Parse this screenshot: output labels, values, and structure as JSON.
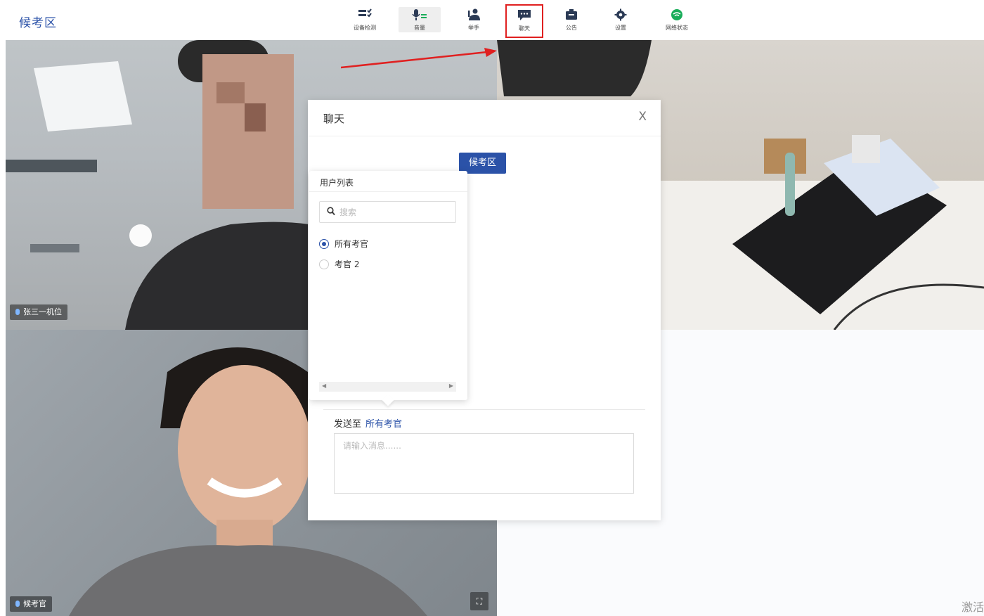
{
  "app": {
    "title": "候考区"
  },
  "toolbar": {
    "items": [
      {
        "label": "设备检测",
        "icon": "device-check-icon"
      },
      {
        "label": "音量",
        "icon": "microphone-volume-icon"
      },
      {
        "label": "举手",
        "icon": "raise-hand-icon"
      },
      {
        "label": "聊天",
        "icon": "chat-icon"
      },
      {
        "label": "公告",
        "icon": "announcement-icon"
      },
      {
        "label": "设置",
        "icon": "gear-icon"
      },
      {
        "label": "网络状态",
        "icon": "network-status-icon"
      }
    ]
  },
  "videos": {
    "tile1_name": "张三一机位",
    "tile3_name": "候考官"
  },
  "chat": {
    "title": "聊天",
    "close": "X",
    "room_tag": "候考区",
    "send_to_label": "发送至",
    "send_to_target": "所有考官",
    "message_placeholder": "请输入消息......"
  },
  "user_list": {
    "title": "用户列表",
    "search_placeholder": "搜索",
    "users": [
      {
        "label": "所有考官",
        "selected": true
      },
      {
        "label": "考官 2",
        "selected": false
      }
    ]
  },
  "watermark": "激活",
  "colors": {
    "accent": "#2b52a8",
    "highlight": "#e02020",
    "network_ok": "#1aad5a"
  }
}
